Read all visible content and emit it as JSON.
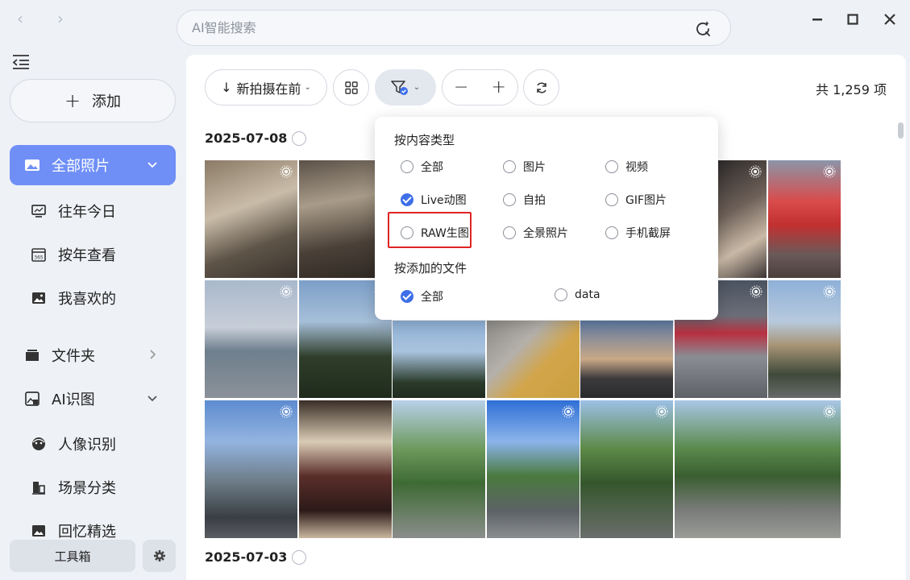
{
  "search": {
    "placeholder": "AI智能搜索"
  },
  "sidebar": {
    "add_label": "添加",
    "items": [
      {
        "label": "全部照片",
        "icon": "photo-icon",
        "active": true
      },
      {
        "label": "往年今日",
        "icon": "monitor-icon"
      },
      {
        "label": "按年查看",
        "icon": "calendar-icon"
      },
      {
        "label": "我喜欢的",
        "icon": "image-icon"
      },
      {
        "label": "文件夹",
        "icon": "folder-icon"
      },
      {
        "label": "AI识图",
        "icon": "ai-image-icon"
      },
      {
        "label": "人像识别",
        "icon": "face-icon"
      },
      {
        "label": "场景分类",
        "icon": "scene-icon"
      },
      {
        "label": "回忆精选",
        "icon": "memory-icon"
      }
    ],
    "toolbox_label": "工具箱"
  },
  "toolbar": {
    "sort_label": "新拍摄在前",
    "count_label": "共 1,259 项"
  },
  "sections": [
    {
      "date": "2025-07-08"
    },
    {
      "date": "2025-07-03"
    }
  ],
  "filter_popup": {
    "content_type_title": "按内容类型",
    "content_types": [
      {
        "label": "全部",
        "checked": false
      },
      {
        "label": "图片",
        "checked": false
      },
      {
        "label": "视频",
        "checked": false
      },
      {
        "label": "Live动图",
        "checked": true
      },
      {
        "label": "自拍",
        "checked": false
      },
      {
        "label": "GIF图片",
        "checked": false
      },
      {
        "label": "RAW生图",
        "checked": false
      },
      {
        "label": "全景照片",
        "checked": false
      },
      {
        "label": "手机截屏",
        "checked": false
      }
    ],
    "source_title": "按添加的文件",
    "sources": [
      {
        "label": "全部",
        "checked": true
      },
      {
        "label": "data",
        "checked": false
      }
    ]
  },
  "colors": {
    "accent": "#6f8ff7",
    "check": "#3f6fe8",
    "highlight": "#e02424"
  }
}
